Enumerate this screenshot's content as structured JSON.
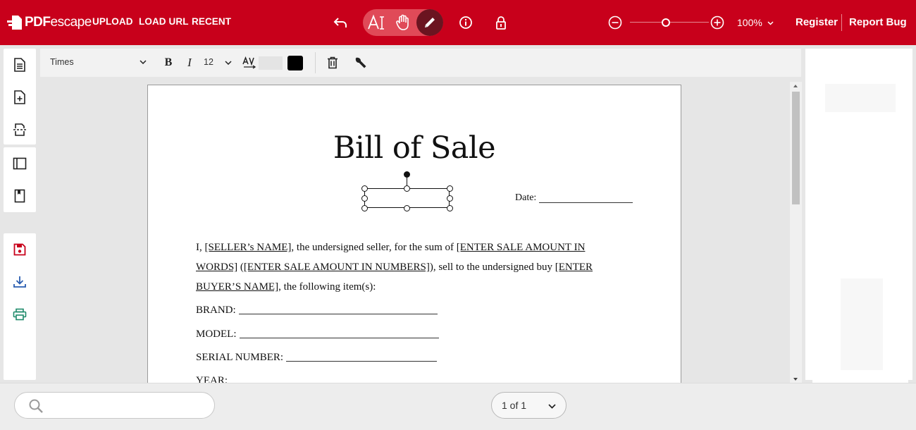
{
  "app": {
    "logo_text_bold": "PDF",
    "logo_text_light": "escape"
  },
  "nav": {
    "upload": "UPLOAD",
    "load_url": "LOAD URL",
    "recent": "RECENT"
  },
  "zoom": {
    "label": "100%",
    "level": 0.45
  },
  "account": {
    "register": "Register",
    "report_bug": "Report Bug"
  },
  "format_toolbar": {
    "font": "Times",
    "bold": "B",
    "italic": "I",
    "size": "12",
    "text_color": "#000000",
    "bg_color": "#e4e4e4"
  },
  "document": {
    "title": "Bill of Sale",
    "date_label": "Date:",
    "para": {
      "t1": "I, ",
      "u1": "[SELLER’s NAME]",
      "t2": ", the undersigned seller, for the sum of ",
      "u2": "[ENTER SALE AMOUNT IN WORDS]",
      "t3": " (",
      "u3": "[ENTER SALE AMOUNT IN NUMBERS]",
      "t4": "), sell to the undersigned buy ",
      "u4": "[ENTER BUYER’S NAME]",
      "t5": ", the following item(s):"
    },
    "fields": [
      "BRAND:",
      "MODEL:",
      "SERIAL NUMBER:",
      "YEAR:"
    ]
  },
  "pager": {
    "label": "1 of 1"
  },
  "search": {
    "placeholder": ""
  },
  "colors": {
    "brand_red": "#c8001b",
    "active_tool": "#6b1420",
    "save_icon": "#c8001b",
    "download_icon": "#2a5db0",
    "print_icon": "#1e8a6a"
  }
}
